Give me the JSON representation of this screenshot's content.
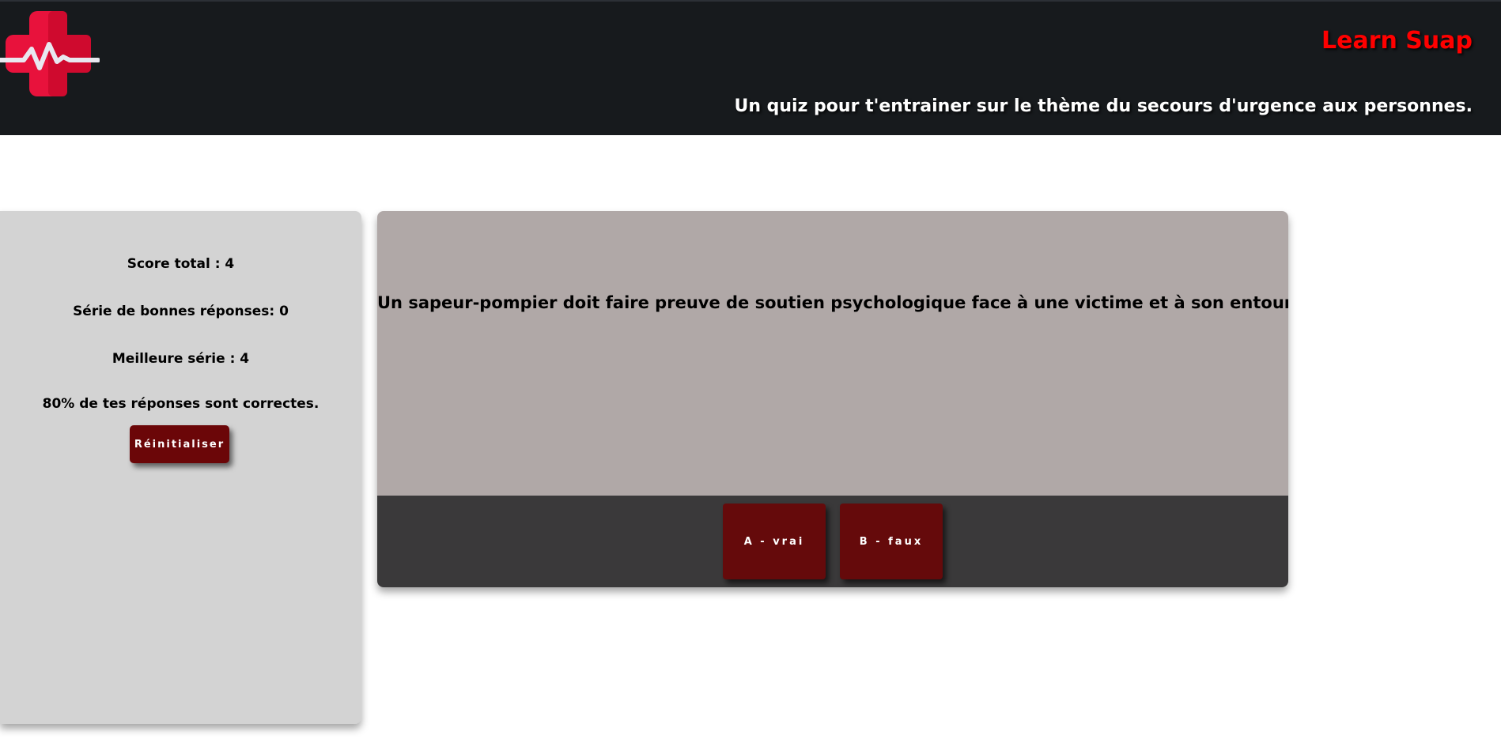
{
  "header": {
    "brand": "Learn Suap",
    "tagline": "Un quiz pour t'entrainer sur le thème du secours d'urgence aux personnes.",
    "brand_color": "#ff0000",
    "background_color": "#171a1d",
    "logo_icon": "medical-cross-heartbeat-icon"
  },
  "stats": {
    "score_total": "Score total : 4",
    "streak": "Série de bonnes réponses: 0",
    "best_streak": "Meilleure série : 4",
    "percent_correct": "80% de tes réponses sont correctes.",
    "reset_label": "Réinitialiser"
  },
  "quiz": {
    "question": "Un sapeur-pompier doit faire preuve de soutien psychologique face à une victime et à son entourage :",
    "answers": [
      {
        "label": "A - vrai"
      },
      {
        "label": "B - faux"
      }
    ],
    "button_color": "#650a0b"
  }
}
